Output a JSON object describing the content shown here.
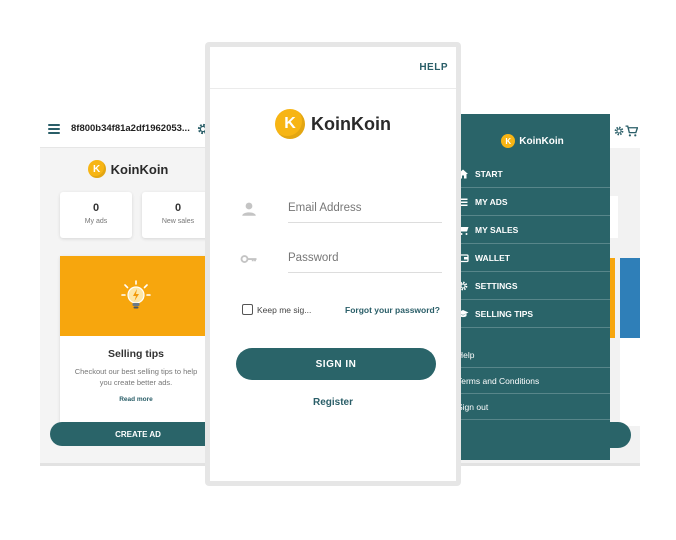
{
  "colors": {
    "brand_teal": "#2a6469",
    "brand_yellow": "#f7b514",
    "card_orange": "#f7a60d"
  },
  "left_screen": {
    "topbar": {
      "wallet_id": "8f800b34f81a2df1962053...",
      "menu_icon": "hamburger-icon",
      "settings_icon": "gear-icon"
    },
    "logo": {
      "text": "KoinKoin",
      "coin_letter": "K"
    },
    "stats": [
      {
        "value": "0",
        "label": "My ads"
      },
      {
        "value": "0",
        "label": "New sales"
      }
    ],
    "tip_card": {
      "icon": "lightbulb-icon",
      "title": "Selling tips",
      "text": "Checkout our best selling tips to help you create better ads.",
      "link": "Read more"
    },
    "create_ad_label": "CREATE AD"
  },
  "login_screen": {
    "help_label": "HELP",
    "logo": {
      "text": "KoinKoin",
      "coin_letter": "K"
    },
    "email": {
      "placeholder": "Email Address",
      "value": "",
      "icon": "user-icon"
    },
    "password": {
      "placeholder": "Password",
      "value": "",
      "icon": "key-icon"
    },
    "remember_label": "Keep me sig...",
    "forgot_label": "Forgot your password?",
    "signin_label": "SIGN IN",
    "register_label": "Register"
  },
  "drawer": {
    "logo": {
      "text": "KoinKoin",
      "coin_letter": "K"
    },
    "items": [
      {
        "label": "START",
        "icon": "home-icon"
      },
      {
        "label": "MY ADS",
        "icon": "list-icon"
      },
      {
        "label": "MY SALES",
        "icon": "cart-icon"
      },
      {
        "label": "WALLET",
        "icon": "wallet-icon"
      },
      {
        "label": "SETTINGS",
        "icon": "gear-icon"
      },
      {
        "label": "SELLING TIPS",
        "icon": "graduation-cap-icon"
      }
    ],
    "secondary": [
      {
        "label": "Help"
      },
      {
        "label": "Terms and Conditions"
      },
      {
        "label": "Sign out"
      }
    ]
  }
}
